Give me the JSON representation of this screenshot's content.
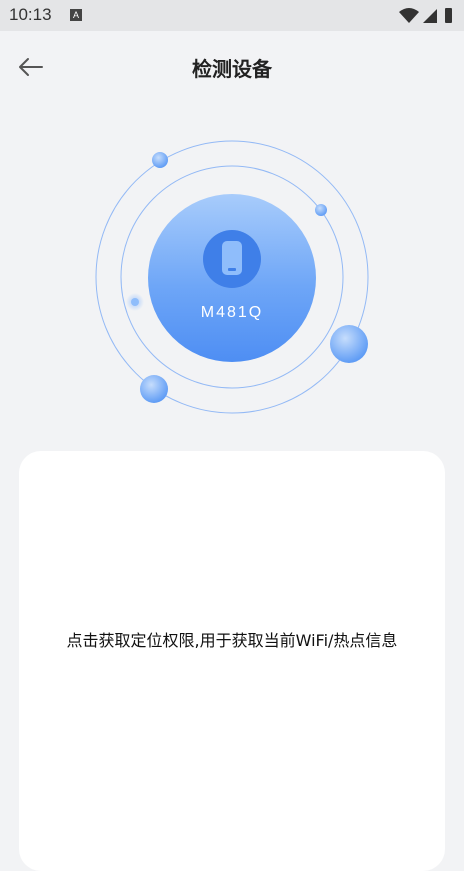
{
  "status_bar": {
    "time": "10:13",
    "notification_icon": "A"
  },
  "header": {
    "title": "检测设备",
    "back_icon": "arrow-left-icon"
  },
  "device": {
    "name": "M481Q",
    "icon": "phone-icon"
  },
  "card": {
    "message": "点击获取定位权限,用于获取当前WiFi/热点信息"
  },
  "colors": {
    "accent": "#4e8ef3",
    "orbit_line": "#8fb6f5",
    "background": "#f2f3f5"
  }
}
